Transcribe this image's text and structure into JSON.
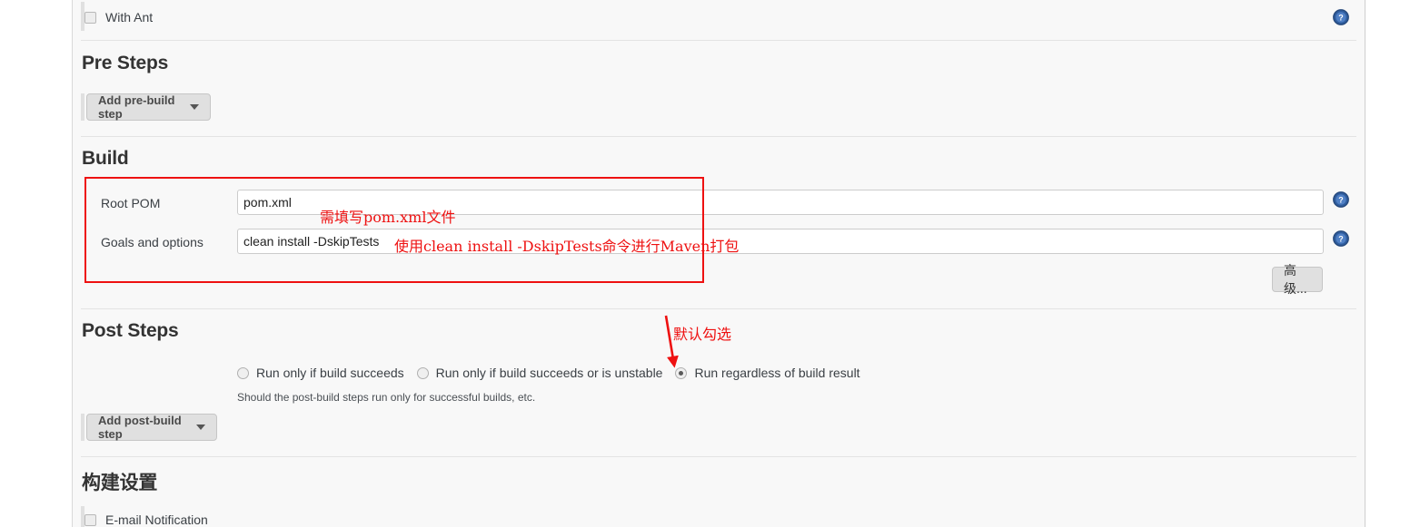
{
  "page": {
    "background": "#f8f8f8",
    "annotation_color": "#ee1111"
  },
  "with_ant": {
    "label": "With Ant",
    "checked": false
  },
  "pre_steps": {
    "title": "Pre Steps",
    "add_button": "Add pre-build step"
  },
  "build": {
    "title": "Build",
    "fields": [
      {
        "label": "Root POM",
        "value": "pom.xml"
      },
      {
        "label": "Goals and options",
        "value": "clean install -DskipTests"
      }
    ],
    "advanced_button": "高级..."
  },
  "post_steps": {
    "title": "Post Steps",
    "radios": [
      {
        "label": "Run only if build succeeds",
        "checked": false
      },
      {
        "label": "Run only if build succeeds or is unstable",
        "checked": false
      },
      {
        "label": "Run regardless of build result",
        "checked": true
      }
    ],
    "hint": "Should the post-build steps run only for successful builds, etc.",
    "add_button": "Add post-build step"
  },
  "build_settings": {
    "title": "构建设置",
    "email_notification": {
      "label": "E-mail Notification",
      "checked": false
    }
  },
  "annotations": [
    {
      "text": "需填写pom.xml文件"
    },
    {
      "text": "使用clean install -DskipTests命令进行Maven打包"
    },
    {
      "text": "默认勾选"
    }
  ],
  "icons": {
    "help": "help-icon",
    "caret": "chevron-down-icon"
  }
}
